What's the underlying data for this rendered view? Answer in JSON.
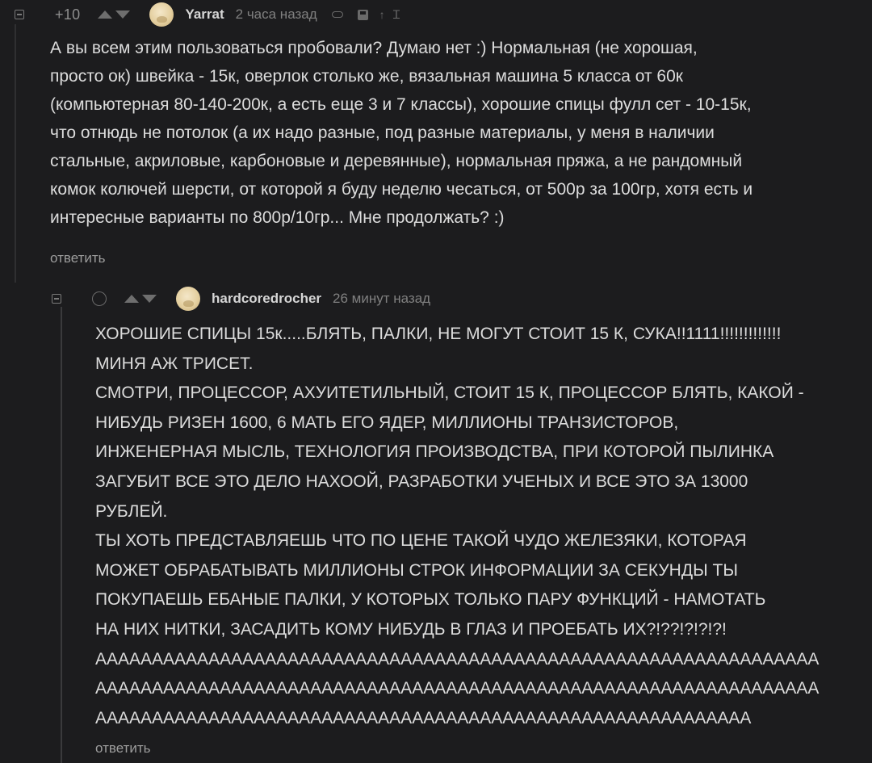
{
  "comments": [
    {
      "rating": "+10",
      "username": "Yarrat",
      "time": "2 часа назад",
      "icons": [
        "collapse-icon",
        "upvote-icon",
        "downvote-icon",
        "avatar",
        "link-icon",
        "save-icon",
        "up-arrow-icon",
        "cursor-icon"
      ],
      "lines": [
        "А вы всем этим пользоваться пробовали? Думаю нет :) Нормальная (не хорошая,",
        "просто ок) швейка - 15к, оверлок столько же, вязальная машина 5 класса от 60к",
        "(компьютерная 80-140-200к, а есть еще 3 и 7 классы), хорошие спицы фулл сет - 10-15к,",
        "что отнюдь не потолок (а их надо разные, под разные материалы, у меня в наличии",
        "стальные, акриловые, карбоновые и деревянные), нормальная пряжа, а не рандомный",
        "комок колючей шерсти, от которой я буду неделю чесаться, от 500р за 100гр, хотя есть и",
        "интересные варианты по 800р/10гр... Мне продолжать? :)"
      ],
      "reply_label": "ответить"
    },
    {
      "rating": "",
      "username": "hardcoredrocher",
      "time": "26 минут назад",
      "icons": [
        "collapse-icon",
        "circle-icon",
        "upvote-icon",
        "downvote-icon",
        "avatar"
      ],
      "lines": [
        "ХОРОШИЕ СПИЦЫ 15к.....БЛЯТЬ, ПАЛКИ, НЕ МОГУТ СТОИТ 15 К, СУКА!!1111!!!!!!!!!!!!!",
        "МИНЯ АЖ ТРИСЕТ.",
        "СМОТРИ, ПРОЦЕССОР, АХУИТЕТИЛЬНЫЙ, СТОИТ 15 К, ПРОЦЕССОР БЛЯТЬ, КАКОЙ -",
        "НИБУДЬ РИЗЕН 1600, 6 МАТЬ ЕГО ЯДЕР, МИЛЛИОНЫ ТРАНЗИСТОРОВ,",
        "ИНЖЕНЕРНАЯ МЫСЛЬ, ТЕХНОЛОГИЯ ПРОИЗВОДСТВА, ПРИ КОТОРОЙ ПЫЛИНКА",
        "ЗАГУБИТ ВСЕ ЭТО ДЕЛО НАХООЙ, РАЗРАБОТКИ УЧЕНЫХ И ВСЕ ЭТО ЗА 13000",
        "РУБЛЕЙ.",
        "ТЫ ХОТЬ ПРЕДСТАВЛЯЕШЬ ЧТО ПО ЦЕНЕ ТАКОЙ ЧУДО ЖЕЛЕЗЯКИ, КОТОРАЯ",
        "МОЖЕТ ОБРАБАТЫВАТЬ МИЛЛИОНЫ СТРОК ИНФОРМАЦИИ ЗА СЕКУНДЫ ТЫ",
        "ПОКУПАЕШЬ ЕБАНЫЕ ПАЛКИ, У КОТОРЫХ ТОЛЬКО ПАРУ ФУНКЦИЙ - НАМОТАТЬ",
        "НА НИХ НИТКИ, ЗАСАДИТЬ КОМУ НИБУДЬ В ГЛАЗ И ПРОЕБАТЬ ИХ?!??!?!?!?!",
        "АААААААААААААААААААААААААААААААААААААААААААААААААААААААААААААААА",
        "АААААААААААААААААААААААААААААААААААААААААААААААААААААААААААААААА",
        "АААААААААААААААААААААААААААААААААААААААААААААААААААААААААА"
      ],
      "reply_label": "ответить"
    }
  ]
}
